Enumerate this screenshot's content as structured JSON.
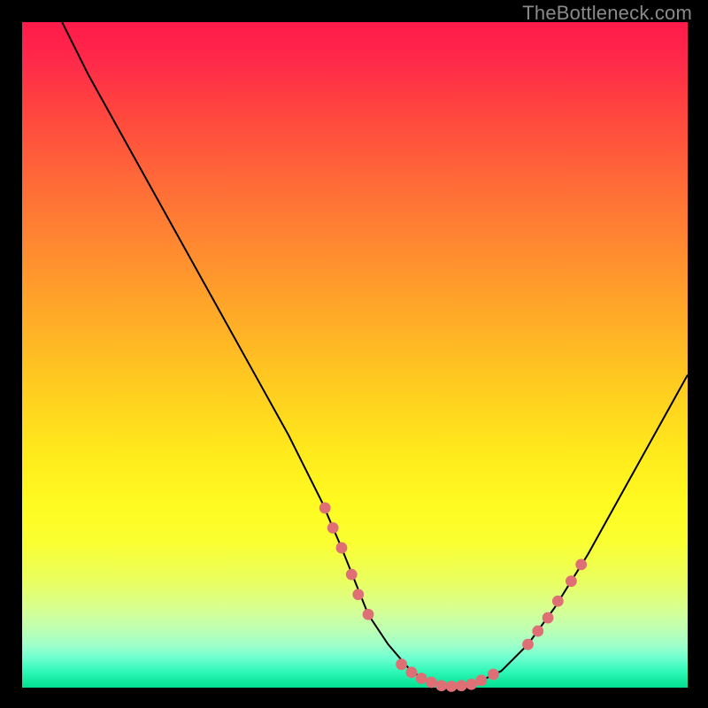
{
  "watermark": "TheBottleneck.com",
  "chart_data": {
    "type": "line",
    "title": "",
    "xlabel": "",
    "ylabel": "",
    "xlim": [
      0,
      100
    ],
    "ylim": [
      0,
      100
    ],
    "grid": false,
    "legend": false,
    "series": [
      {
        "name": "curve",
        "x": [
          6,
          10,
          15,
          20,
          25,
          30,
          35,
          40,
          45,
          48,
          50,
          52,
          55,
          58,
          60,
          62,
          65,
          68,
          72,
          76,
          80,
          85,
          90,
          95,
          100
        ],
        "y": [
          100,
          92,
          83,
          74,
          65,
          56,
          47,
          38,
          28,
          21,
          16,
          11,
          6.5,
          3,
          1.4,
          0.6,
          0.2,
          0.6,
          2.5,
          6.5,
          12,
          20,
          29,
          38,
          47
        ],
        "color": "#000000",
        "stroke_width": 2
      }
    ],
    "markers": {
      "name": "dots",
      "color": "#de6f75",
      "radius": 6.4,
      "points": [
        {
          "x": 45.5,
          "y": 27.0
        },
        {
          "x": 46.7,
          "y": 24.0
        },
        {
          "x": 48.0,
          "y": 21.0
        },
        {
          "x": 49.5,
          "y": 17.0
        },
        {
          "x": 50.5,
          "y": 14.0
        },
        {
          "x": 52.0,
          "y": 11.0
        },
        {
          "x": 57.0,
          "y": 3.5
        },
        {
          "x": 58.5,
          "y": 2.3
        },
        {
          "x": 60.0,
          "y": 1.4
        },
        {
          "x": 61.5,
          "y": 0.8
        },
        {
          "x": 63.0,
          "y": 0.3
        },
        {
          "x": 64.5,
          "y": 0.2
        },
        {
          "x": 66.0,
          "y": 0.3
        },
        {
          "x": 67.5,
          "y": 0.5
        },
        {
          "x": 69.0,
          "y": 1.1
        },
        {
          "x": 70.8,
          "y": 2.0
        },
        {
          "x": 76.0,
          "y": 6.5
        },
        {
          "x": 77.5,
          "y": 8.5
        },
        {
          "x": 79.0,
          "y": 10.5
        },
        {
          "x": 80.5,
          "y": 13.0
        },
        {
          "x": 82.5,
          "y": 16.0
        },
        {
          "x": 84.0,
          "y": 18.5
        }
      ]
    }
  }
}
